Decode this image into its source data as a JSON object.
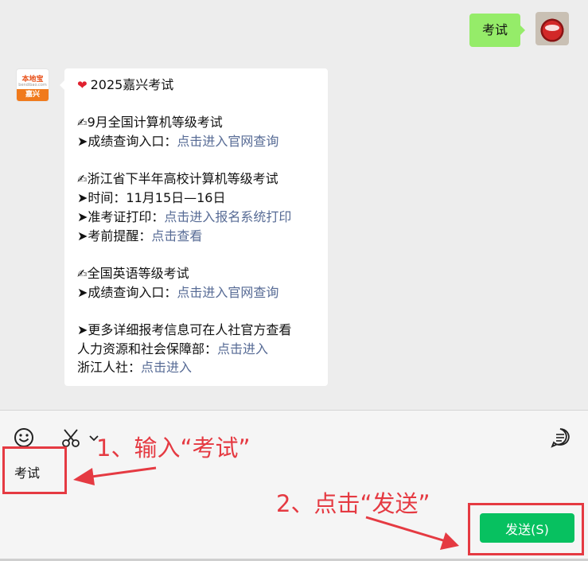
{
  "chat": {
    "user_message": "考试",
    "bot_avatar": {
      "top_text": "本地宝",
      "mid_text": "bendibao.com",
      "bar_text": "嘉兴"
    },
    "reply_lines": [
      {
        "kind": "title",
        "text": "2025嘉兴考试",
        "icon": "heart"
      },
      {
        "kind": "gap"
      },
      {
        "kind": "text",
        "prefix": "✍",
        "text": "9月全国计算机等级考试"
      },
      {
        "kind": "text",
        "text": "➤成绩查询入口：",
        "link": "点击进入官网查询"
      },
      {
        "kind": "gap"
      },
      {
        "kind": "text",
        "prefix": "✍",
        "text": "浙江省下半年高校计算机等级考试"
      },
      {
        "kind": "text",
        "text": "➤时间：11月15日—16日"
      },
      {
        "kind": "text",
        "text": "➤准考证打印：",
        "link": "点击进入报名系统打印"
      },
      {
        "kind": "text",
        "text": "➤考前提醒：",
        "link": "点击查看"
      },
      {
        "kind": "gap"
      },
      {
        "kind": "text",
        "prefix": "✍",
        "text": "全国英语等级考试"
      },
      {
        "kind": "text",
        "text": "➤成绩查询入口：",
        "link": "点击进入官网查询"
      },
      {
        "kind": "gap"
      },
      {
        "kind": "text",
        "text": "➤更多详细报考信息可在人社官方查看"
      },
      {
        "kind": "text",
        "text": "人力资源和社会保障部：",
        "link": "点击进入"
      },
      {
        "kind": "text",
        "text": "浙江人社：",
        "link": "点击进入"
      }
    ]
  },
  "toolbar": {
    "emoji_icon": "smiley-icon",
    "screenshot_icon": "scissors-icon",
    "chat_history_icon": "chat-history-icon"
  },
  "input": {
    "value": "考试"
  },
  "send_button": {
    "label": "发送(S)"
  },
  "annotations": {
    "step1": "1、输入“考试”",
    "step2": "2、点击“发送”",
    "color": "#e53a42"
  },
  "colors": {
    "user_bubble": "#95ec69",
    "link": "#576b95",
    "send": "#07c160"
  }
}
